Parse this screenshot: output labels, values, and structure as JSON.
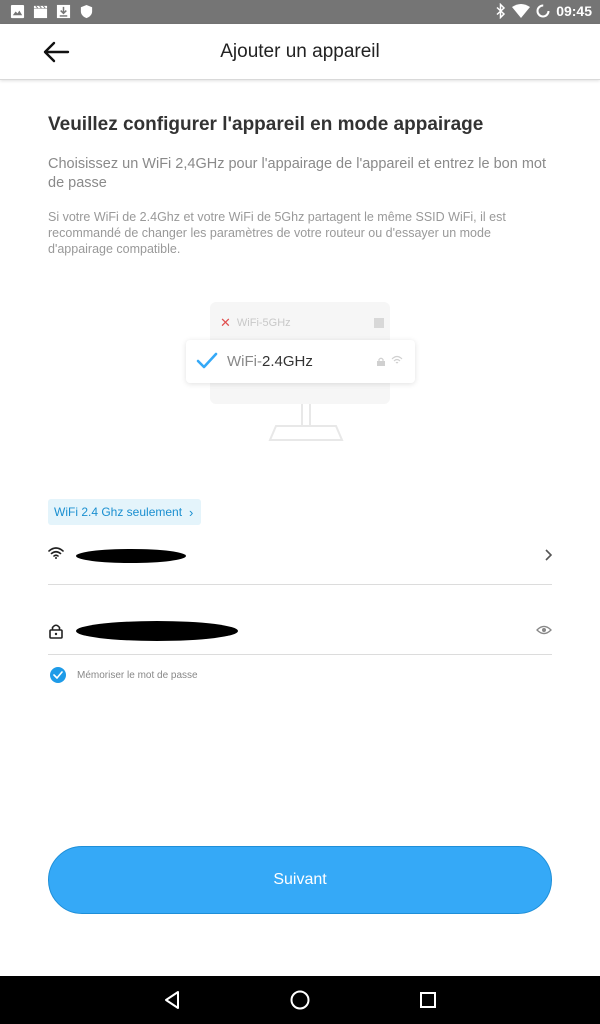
{
  "status_bar": {
    "time": "09:45",
    "left_icons": [
      "image-icon",
      "clapper-icon",
      "download-icon",
      "shield-icon"
    ],
    "right_icons": [
      "bluetooth-icon",
      "wifi-signal-icon",
      "battery-charging-icon"
    ]
  },
  "header": {
    "title": "Ajouter un appareil",
    "back_icon": "arrow-left-icon"
  },
  "main": {
    "heading": "Veuillez configurer l'appareil en mode appairage",
    "description": "Choisissez un WiFi 2,4GHz pour l'appairage de l'appareil et entrez le bon mot de passe",
    "note": "Si votre WiFi de 2.4Ghz et votre WiFi de 5Ghz partagent le même SSID WiFi, il est recommandé de changer les paramètres de votre routeur ou d'essayer un mode d'appairage compatible."
  },
  "illustration": {
    "wifi_5g_label": "WiFi-5GHz",
    "wifi_24_prefix": "WiFi-",
    "wifi_24_suffix": "2.4GHz"
  },
  "form": {
    "badge_label": "WiFi 2.4 Ghz seulement",
    "ssid_icon": "wifi-icon",
    "ssid_chevron": "chevron-right-icon",
    "password_icon": "lock-icon",
    "password_toggle": "eye-icon",
    "remember_label": "Mémoriser le mot de passe",
    "remember_checked": true
  },
  "actions": {
    "next_label": "Suivant"
  },
  "nav_bar": {
    "icons": [
      "back-triangle-icon",
      "home-circle-icon",
      "recents-square-icon"
    ]
  },
  "colors": {
    "accent": "#35a9f7",
    "accent_border": "#1e8fd8",
    "badge_bg": "#e4f4fb",
    "badge_text": "#1a8fd0",
    "status_bar": "#757575",
    "nav_bar": "#000000",
    "error_red": "#e05050"
  }
}
